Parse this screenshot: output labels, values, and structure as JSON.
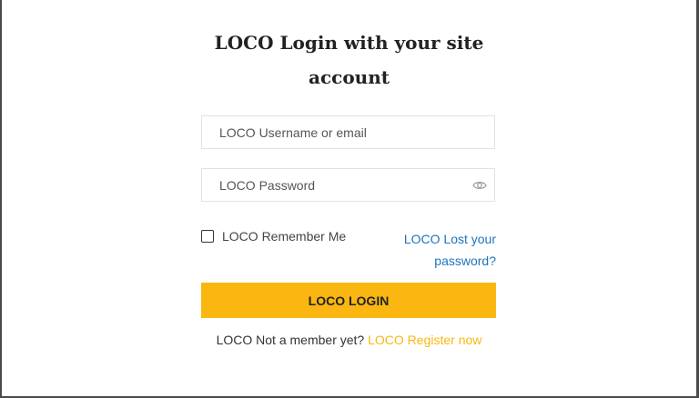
{
  "modal": {
    "title_line1": "LOCO Login with your site",
    "title_line2": "account",
    "username": {
      "value": "",
      "placeholder": "LOCO Username or email"
    },
    "password": {
      "value": "",
      "placeholder": "LOCO Password"
    },
    "password_toggle_icon": "eye-icon",
    "remember_me": {
      "label": "LOCO Remember Me",
      "checked": false
    },
    "lost_password": {
      "line1": "LOCO Lost your",
      "line2": "password?"
    },
    "login_button": "LOCO LOGIN",
    "footer": {
      "text": "LOCO Not a member yet?",
      "link": "LOCO Register now"
    },
    "colors": {
      "accent": "#fbb711",
      "link": "#1e73be"
    }
  }
}
